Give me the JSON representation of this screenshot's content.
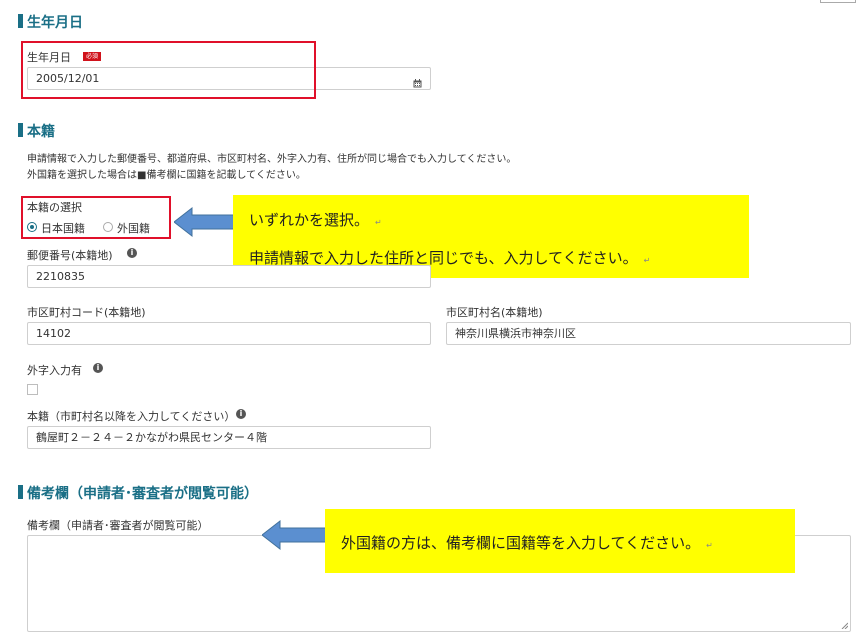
{
  "section_birth": {
    "title": "生年月日"
  },
  "birth": {
    "label": "生年月日",
    "required_badge": "必須",
    "value": "2005/12/01",
    "icon": "calendar-icon"
  },
  "section_honseki": {
    "title": "本籍",
    "desc_line1": "申請情報で入力した郵便番号、都道府県、市区町村名、外字入力有、住所が同じ場合でも入力してください。",
    "desc_line2": "外国籍を選択した場合は■備考欄に国籍を記載してください。"
  },
  "honseki_select": {
    "label": "本籍の選択",
    "options": [
      "日本国籍",
      "外国籍"
    ],
    "selected": "日本国籍"
  },
  "postal": {
    "label": "郵便番号(本籍地)",
    "value": "2210835"
  },
  "city_code": {
    "label": "市区町村コード(本籍地)",
    "value": "14102"
  },
  "city_name": {
    "label": "市区町村名(本籍地)",
    "value": "神奈川県横浜市神奈川区"
  },
  "gaiji": {
    "label": "外字入力有"
  },
  "honseki_addr": {
    "label": "本籍（市町村名以降を入力してください）",
    "value": "鶴屋町２－２４－２かながわ県民センター４階"
  },
  "section_remarks": {
    "title": "備考欄（申請者･審査者が閲覧可能）"
  },
  "remarks": {
    "label": "備考欄（申請者･審査者が閲覧可能）",
    "value": ""
  },
  "callout_1": {
    "line1": "いずれかを選択。",
    "line2": "申請情報で入力した住所と同じでも、入力してください。",
    "mark": "↵"
  },
  "callout_2": {
    "line1": "外国籍の方は、備考欄に国籍等を入力してください。",
    "mark": "↵"
  },
  "colors": {
    "accent": "#1a6f86",
    "highlight": "#ffff00",
    "alert_red": "#e0102a",
    "arrow_blue": "#5b8fd0"
  }
}
